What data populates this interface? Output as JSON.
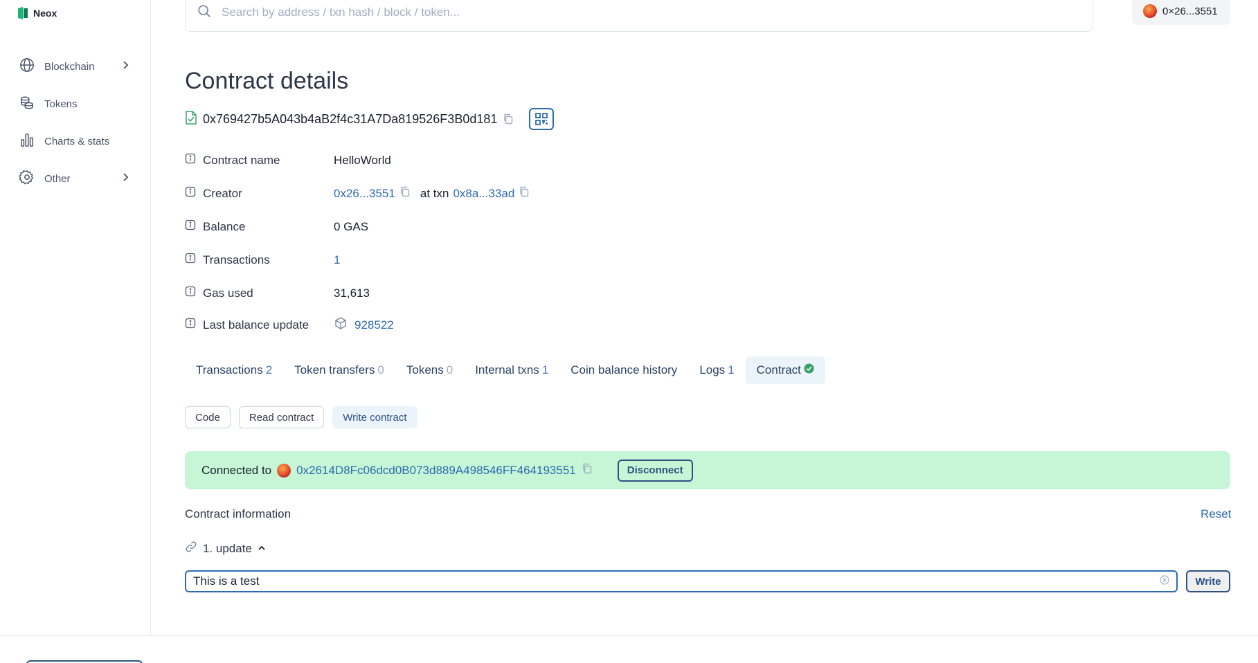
{
  "brand": {
    "name": "Neox",
    "logo_color": "#1db37a"
  },
  "sidebar": {
    "items": [
      {
        "label": "Blockchain",
        "icon": "globe-icon",
        "has_chevron": true
      },
      {
        "label": "Tokens",
        "icon": "coins-icon",
        "has_chevron": false
      },
      {
        "label": "Charts & stats",
        "icon": "bar-chart-icon",
        "has_chevron": false
      },
      {
        "label": "Other",
        "icon": "gear-icon",
        "has_chevron": true
      }
    ]
  },
  "search": {
    "placeholder": "Search by address / txn hash / block / token..."
  },
  "wallet": {
    "label": "0×26...3551"
  },
  "page": {
    "title": "Contract details",
    "address": "0x769427b5A043b4aB2f4c31A7Da819526F3B0d181"
  },
  "details": {
    "contract_name": {
      "label": "Contract name",
      "value": "HelloWorld"
    },
    "creator": {
      "label": "Creator",
      "address": "0x26...3551",
      "at_txn": "at txn",
      "txn": "0x8a...33ad"
    },
    "balance": {
      "label": "Balance",
      "value": "0 GAS"
    },
    "transactions": {
      "label": "Transactions",
      "value": "1"
    },
    "gas_used": {
      "label": "Gas used",
      "value": "31,613"
    },
    "last_balance_update": {
      "label": "Last balance update",
      "value": "928522"
    }
  },
  "tabs": [
    {
      "label": "Transactions",
      "count": "2"
    },
    {
      "label": "Token transfers",
      "count": "0"
    },
    {
      "label": "Tokens",
      "count": "0"
    },
    {
      "label": "Internal txns",
      "count": "1"
    },
    {
      "label": "Coin balance history",
      "count": ""
    },
    {
      "label": "Logs",
      "count": "1"
    },
    {
      "label": "Contract",
      "count": "",
      "active": true,
      "verified": true
    }
  ],
  "subtabs": [
    {
      "label": "Code"
    },
    {
      "label": "Read contract"
    },
    {
      "label": "Write contract",
      "active": true
    }
  ],
  "connection": {
    "prefix": "Connected to",
    "address": "0x2614D8Fc06dcd0B073d889A498546FF464193551",
    "disconnect_label": "Disconnect"
  },
  "contract_info": {
    "title": "Contract information",
    "reset_label": "Reset",
    "method_label": "1. update",
    "input_value": "This is a test",
    "write_label": "Write"
  },
  "colors": {
    "accent": "#2b6cb0",
    "connected_bg": "#c6f6d5",
    "active_tab_bg": "#ebf4fb",
    "verified": "#38a169"
  }
}
